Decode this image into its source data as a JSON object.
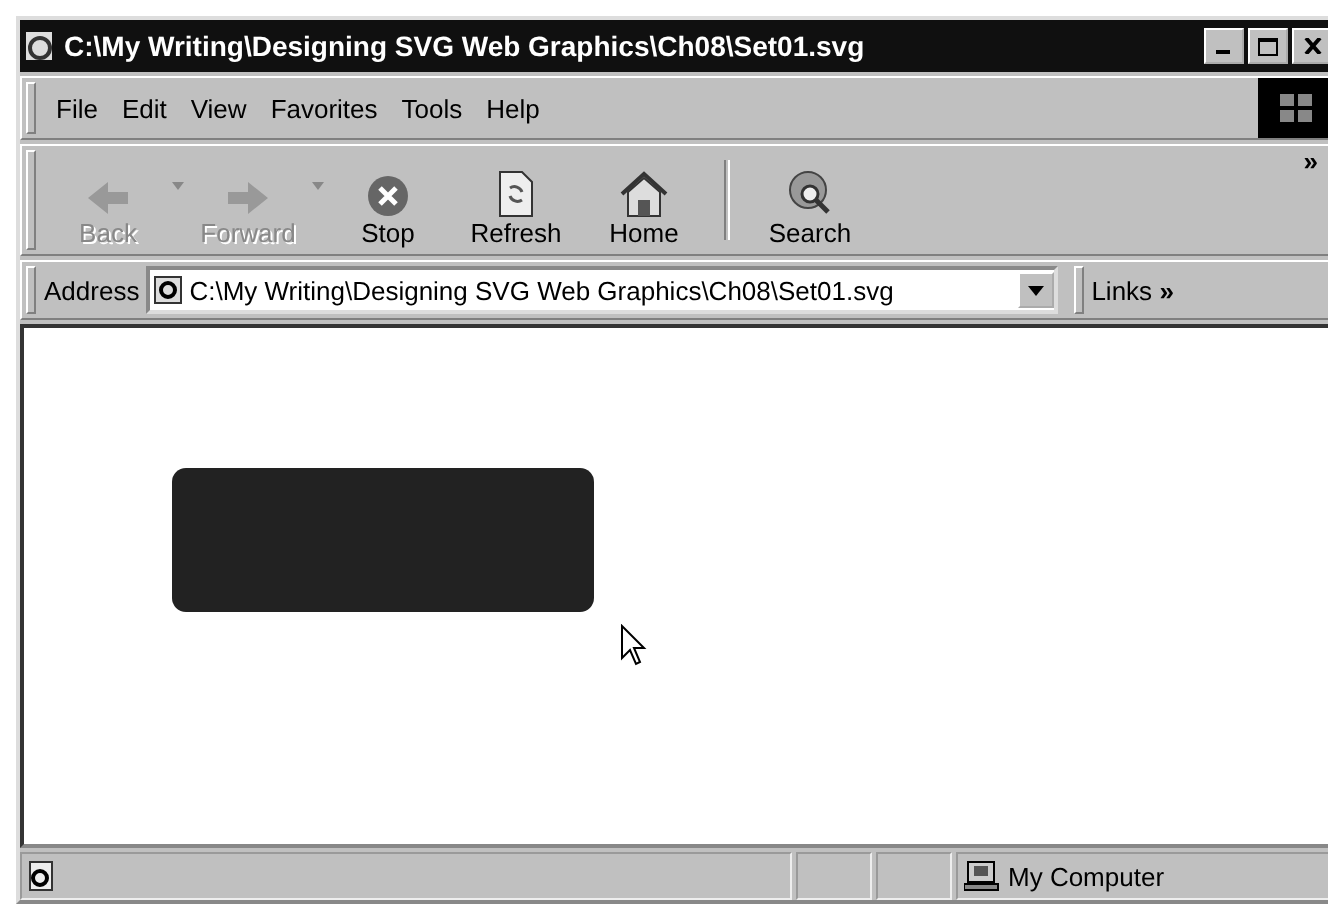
{
  "window": {
    "title": "C:\\My Writing\\Designing SVG Web Graphics\\Ch08\\Set01.svg"
  },
  "menu": [
    "File",
    "Edit",
    "View",
    "Favorites",
    "Tools",
    "Help"
  ],
  "toolbar": [
    {
      "kind": "back",
      "label": "Back",
      "disabled": true,
      "dropdown": true
    },
    {
      "kind": "forward",
      "label": "Forward",
      "disabled": true,
      "dropdown": true
    },
    {
      "kind": "stop",
      "label": "Stop",
      "disabled": false,
      "dropdown": false
    },
    {
      "kind": "refresh",
      "label": "Refresh",
      "disabled": false,
      "dropdown": false
    },
    {
      "kind": "home",
      "label": "Home",
      "disabled": false,
      "dropdown": false
    },
    {
      "kind": "search",
      "label": "Search",
      "disabled": false,
      "dropdown": false
    }
  ],
  "toolbar_more": "»",
  "address": {
    "label": "Address",
    "value": "C:\\My Writing\\Designing SVG Web Graphics\\Ch08\\Set01.svg"
  },
  "links": {
    "label": "Links",
    "more": "»"
  },
  "status_bar": {
    "zone": "My Computer"
  }
}
